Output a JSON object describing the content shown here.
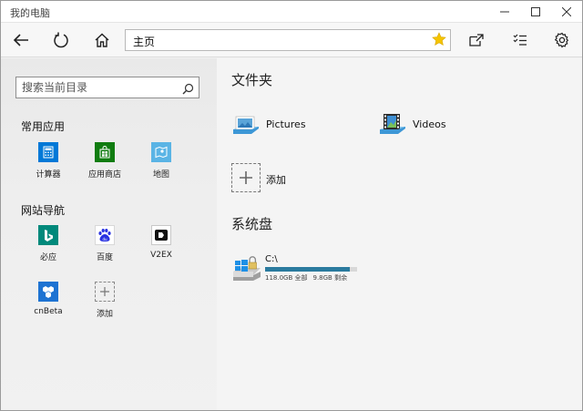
{
  "window": {
    "title": "我的电脑"
  },
  "address": {
    "value": "主页"
  },
  "search": {
    "placeholder": "搜索当前目录"
  },
  "left": {
    "apps_title": "常用应用",
    "apps": [
      {
        "label": "计算器",
        "icon": "calculator-icon",
        "color": "#0078d7"
      },
      {
        "label": "应用商店",
        "icon": "store-icon",
        "color": "#107c10"
      },
      {
        "label": "地图",
        "icon": "maps-icon",
        "color": "#5ab4e5"
      }
    ],
    "sites_title": "网站导航",
    "sites": [
      {
        "label": "必应",
        "icon": "bing-icon",
        "color": "#00897b"
      },
      {
        "label": "百度",
        "icon": "baidu-icon",
        "color": "#2932e1"
      },
      {
        "label": "V2EX",
        "icon": "v2ex-icon",
        "color": "#000000"
      },
      {
        "label": "cnBeta",
        "icon": "cnbeta-icon",
        "color": "#1e73d2"
      },
      {
        "label": "添加",
        "icon": "add-icon",
        "color": "#888888"
      }
    ]
  },
  "right": {
    "folders_title": "文件夹",
    "folders": [
      {
        "label": "Pictures",
        "icon": "pictures-folder-icon"
      },
      {
        "label": "Videos",
        "icon": "videos-folder-icon"
      }
    ],
    "add_label": "添加",
    "drives_title": "系统盘",
    "drive": {
      "name": "C:\\",
      "total": "118.0GB 全部",
      "free": "9.8GB 剩余",
      "used_fraction": 0.917
    }
  }
}
